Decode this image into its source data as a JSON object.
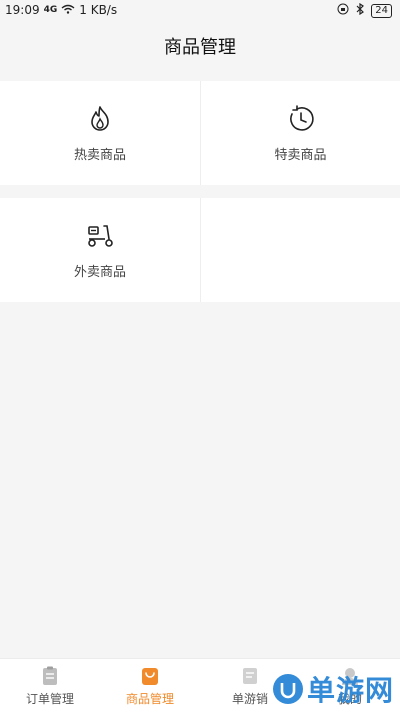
{
  "status_bar": {
    "time": "19:09",
    "signal": "4G",
    "speed": "1 KB/s",
    "battery": "24"
  },
  "header": {
    "title": "商品管理"
  },
  "grid": [
    {
      "label": "热卖商品",
      "icon": "flame-icon"
    },
    {
      "label": "特卖商品",
      "icon": "clock-icon"
    },
    {
      "label": "外卖商品",
      "icon": "scooter-icon"
    }
  ],
  "tabbar": {
    "items": [
      {
        "label": "订单管理",
        "icon": "clipboard-icon",
        "active": false
      },
      {
        "label": "商品管理",
        "icon": "shopping-bag-icon",
        "active": true
      },
      {
        "label": "单游销",
        "icon": "document-icon",
        "active": false
      },
      {
        "label": "我的",
        "icon": "user-icon",
        "active": false
      }
    ]
  },
  "watermark": {
    "text": "单游网"
  },
  "colors": {
    "accent": "#f08a2a",
    "watermark": "#2a86d6",
    "background": "#f5f5f5"
  }
}
